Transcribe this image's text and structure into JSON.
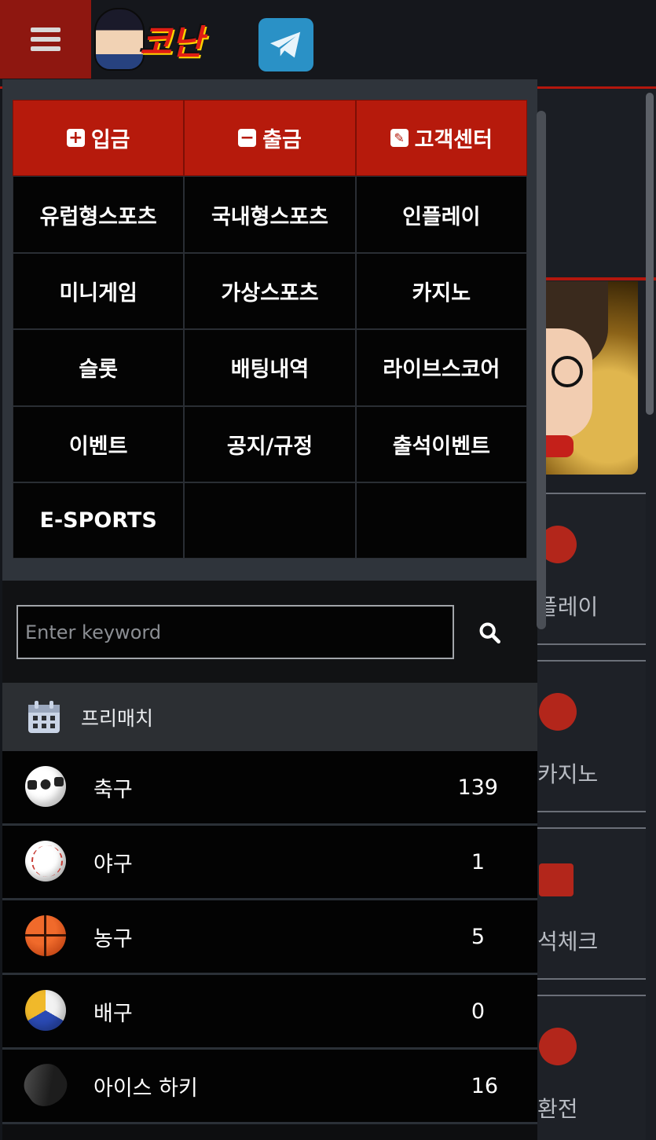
{
  "header": {
    "logo_text": "코난",
    "menu_icon": "hamburger-icon",
    "telegram_icon": "telegram-icon"
  },
  "background_menu": {
    "items": [
      {
        "label": "플레이",
        "icon": "volleyball-icon"
      },
      {
        "label": "카지노",
        "icon": "casino-chip-icon"
      },
      {
        "label": "석체크",
        "icon": "gift-icon"
      },
      {
        "label": "환전",
        "icon": "money-bag-icon"
      }
    ]
  },
  "drawer": {
    "menu": [
      {
        "label": "입금",
        "icon": "plus-square-icon",
        "style": "red"
      },
      {
        "label": "출금",
        "icon": "minus-square-icon",
        "style": "red"
      },
      {
        "label": "고객센터",
        "icon": "edit-icon",
        "style": "red"
      },
      {
        "label": "유럽형스포츠"
      },
      {
        "label": "국내형스포츠"
      },
      {
        "label": "인플레이"
      },
      {
        "label": "미니게임"
      },
      {
        "label": "가상스포츠"
      },
      {
        "label": "카지노"
      },
      {
        "label": "슬롯"
      },
      {
        "label": "배팅내역"
      },
      {
        "label": "라이브스코어"
      },
      {
        "label": "이벤트"
      },
      {
        "label": "공지/규정"
      },
      {
        "label": "출석이벤트"
      },
      {
        "label": "E-SPORTS"
      },
      {
        "label": ""
      },
      {
        "label": ""
      }
    ],
    "search": {
      "placeholder": "Enter keyword",
      "value": "",
      "icon": "search-icon"
    },
    "section": {
      "title": "프리매치",
      "icon": "calendar-icon"
    },
    "sports": [
      {
        "name": "축구",
        "count": "139",
        "icon": "soccer-ball-icon"
      },
      {
        "name": "야구",
        "count": "1",
        "icon": "baseball-icon"
      },
      {
        "name": "농구",
        "count": "5",
        "icon": "basketball-icon"
      },
      {
        "name": "배구",
        "count": "0",
        "icon": "volleyball-icon"
      },
      {
        "name": "아이스 하키",
        "count": "16",
        "icon": "hockey-puck-icon"
      }
    ]
  },
  "colors": {
    "accent_red": "#b61a0c",
    "header_bg": "#15171c",
    "drawer_bg": "#0d0e10",
    "panel_gray": "#2f343b"
  }
}
